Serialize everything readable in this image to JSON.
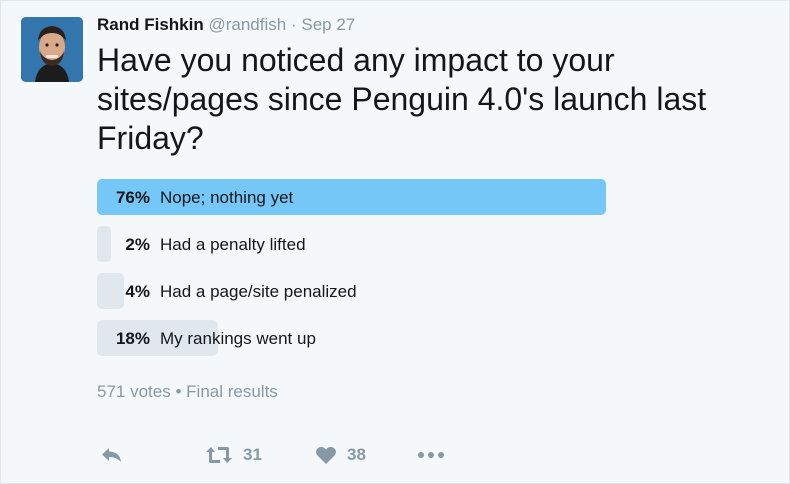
{
  "tweet": {
    "author_name": "Rand Fishkin",
    "handle": "@randfish",
    "separator": "·",
    "date": "Sep 27",
    "text": "Have you noticed any impact to your sites/pages since Penguin 4.0's launch last Friday?"
  },
  "poll": {
    "options": [
      {
        "percent_label": "76%",
        "percent": 76,
        "label": "Nope; nothing yet",
        "winner": true
      },
      {
        "percent_label": "2%",
        "percent": 2,
        "label": "Had a penalty lifted",
        "winner": false
      },
      {
        "percent_label": "4%",
        "percent": 4,
        "label": "Had a page/site penalized",
        "winner": false
      },
      {
        "percent_label": "18%",
        "percent": 18,
        "label": "My rankings went up",
        "winner": false
      }
    ],
    "votes": "571 votes",
    "meta_separator": "•",
    "status": "Final results"
  },
  "actions": {
    "reply_icon": "reply-icon",
    "retweet_icon": "retweet-icon",
    "retweet_count": "31",
    "like_icon": "heart-icon",
    "like_count": "38",
    "more_icon": "more-dots-icon"
  },
  "colors": {
    "winner_bar": "#74c7f6",
    "other_bar": "#e1e8ed",
    "muted_text": "#8899a6",
    "background": "#f5f8fa"
  }
}
